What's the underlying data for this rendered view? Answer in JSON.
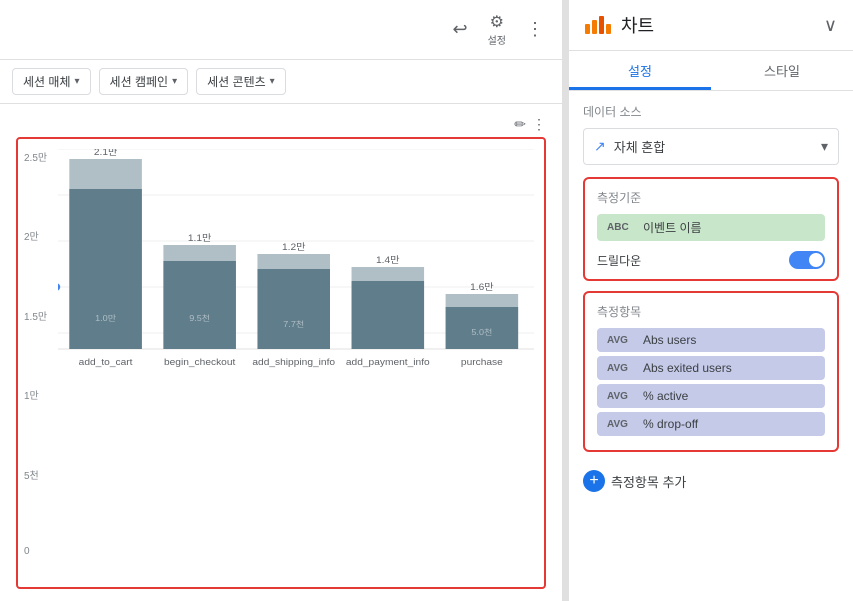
{
  "topbar": {
    "undo_label": "↩",
    "settings_label": "설정",
    "more_icon": "⋮"
  },
  "filters": [
    {
      "label": "세션 매체",
      "id": "filter-session-medium"
    },
    {
      "label": "세션 캠페인",
      "id": "filter-session-campaign"
    },
    {
      "label": "세션 콘텐츠",
      "id": "filter-session-content"
    }
  ],
  "chart": {
    "edit_icon": "✏",
    "more_icon": "⋮",
    "bars": [
      {
        "label": "2.1만",
        "x_label": "add_to_cart",
        "dark_h": 170,
        "light_h": 32
      },
      {
        "label": "1.1만",
        "x_label": "begin_checkout",
        "dark_h": 88,
        "light_h": 14
      },
      {
        "label": "1.2만",
        "x_label": "add_shipping_info",
        "dark_h": 76,
        "light_h": 12
      },
      {
        "label": "1.4만",
        "x_label": "add_payment_info",
        "dark_h": 62,
        "light_h": 10
      },
      {
        "label": "1.6만",
        "x_label": "purchase",
        "dark_h": 41,
        "light_h": 8
      }
    ],
    "y_labels": [
      "2.5만",
      "2만",
      "1.5만",
      "1만",
      "5천",
      "0"
    ]
  },
  "right_panel": {
    "title": "차트",
    "tab_settings": "설정",
    "tab_style": "스타일",
    "data_source_section": "데이터 소스",
    "data_source_icon": "↗",
    "data_source_name": "자체 혼합",
    "metrics_section": "측정기준",
    "dimension_chip": {
      "tag": "ABC",
      "label": "이벤트 이름"
    },
    "drilldown_label": "드릴다운",
    "measures_section": "측정항목",
    "measures": [
      {
        "tag": "AVG",
        "label": "Abs users"
      },
      {
        "tag": "AVG",
        "label": "Abs exited users"
      },
      {
        "tag": "AVG",
        "label": "% active"
      },
      {
        "tag": "AVG",
        "label": "% drop-off"
      }
    ],
    "add_metric_label": "측정항목 추가"
  }
}
